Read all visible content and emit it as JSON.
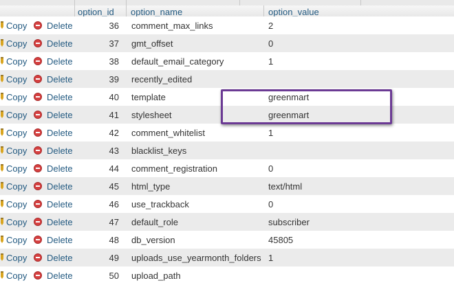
{
  "table": {
    "columns": [
      "option_id",
      "option_name",
      "option_value"
    ],
    "actions": {
      "copy_label": "Copy",
      "delete_label": "Delete"
    },
    "rows": [
      {
        "option_id": "36",
        "option_name": "comment_max_links",
        "option_value": "2"
      },
      {
        "option_id": "37",
        "option_name": "gmt_offset",
        "option_value": "0"
      },
      {
        "option_id": "38",
        "option_name": "default_email_category",
        "option_value": "1"
      },
      {
        "option_id": "39",
        "option_name": "recently_edited",
        "option_value": ""
      },
      {
        "option_id": "40",
        "option_name": "template",
        "option_value": "greenmart"
      },
      {
        "option_id": "41",
        "option_name": "stylesheet",
        "option_value": "greenmart"
      },
      {
        "option_id": "42",
        "option_name": "comment_whitelist",
        "option_value": "1"
      },
      {
        "option_id": "43",
        "option_name": "blacklist_keys",
        "option_value": ""
      },
      {
        "option_id": "44",
        "option_name": "comment_registration",
        "option_value": "0"
      },
      {
        "option_id": "45",
        "option_name": "html_type",
        "option_value": "text/html"
      },
      {
        "option_id": "46",
        "option_name": "use_trackback",
        "option_value": "0"
      },
      {
        "option_id": "47",
        "option_name": "default_role",
        "option_value": "subscriber"
      },
      {
        "option_id": "48",
        "option_name": "db_version",
        "option_value": "45805"
      },
      {
        "option_id": "49",
        "option_name": "uploads_use_yearmonth_folders",
        "option_value": "1"
      },
      {
        "option_id": "50",
        "option_name": "upload_path",
        "option_value": ""
      }
    ]
  },
  "colors": {
    "link": "#235a81",
    "row_alt": "#ebebeb",
    "highlight_border": "#6b3a94",
    "delete_icon": "#d64040"
  },
  "icons": {
    "edit": "pencil-icon",
    "delete": "delete-icon"
  }
}
